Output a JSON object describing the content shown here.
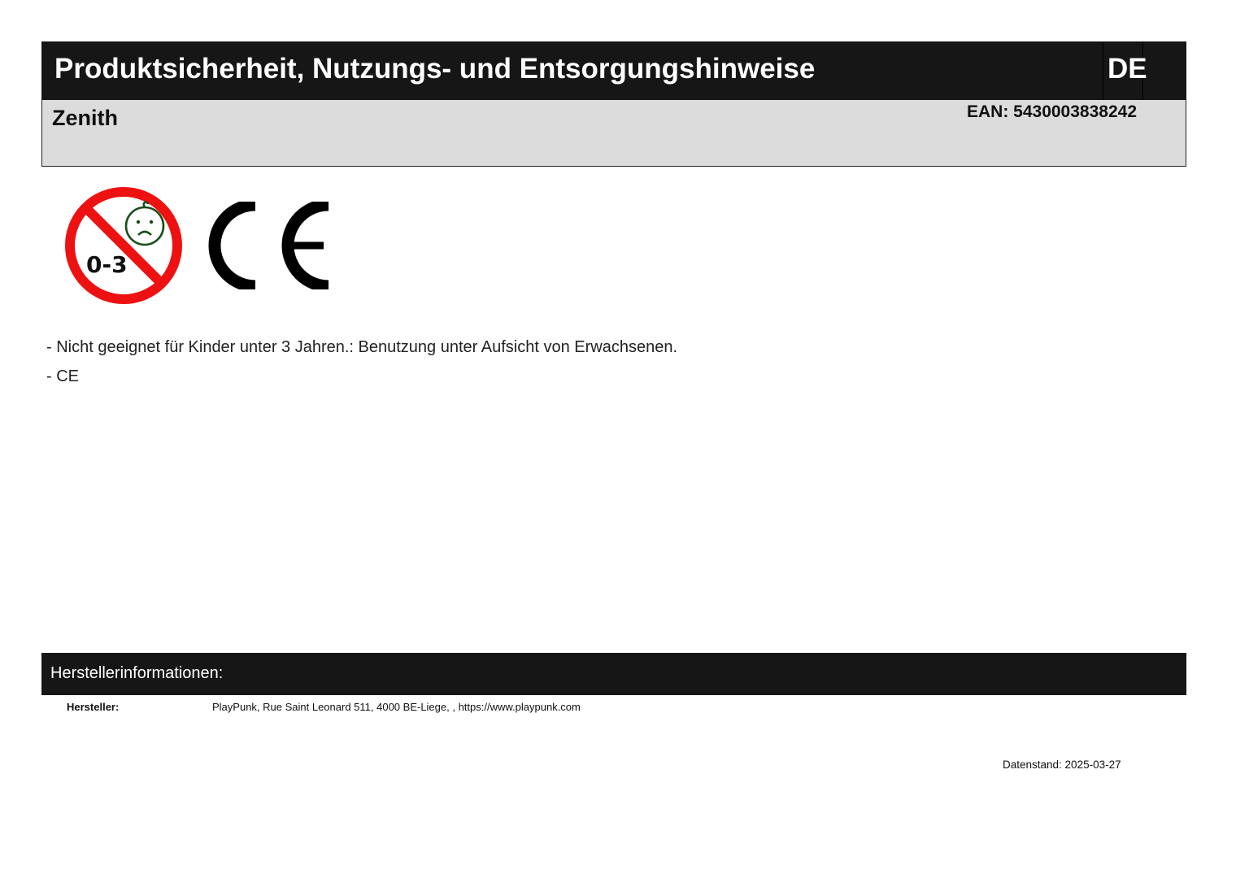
{
  "header": {
    "title": "Produktsicherheit, Nutzungs- und Entsorgungshinweise",
    "language": "DE"
  },
  "product": {
    "name": "Zenith",
    "ean": "EAN: 5430003838242"
  },
  "icons": {
    "age_warning": {
      "name": "not-for-under-3-icon",
      "label": "0-3",
      "ring_color": "#ee1111",
      "face_color": "#1a4d1a"
    },
    "ce_mark": {
      "name": "ce-mark-icon"
    }
  },
  "bullets": [
    "- Nicht geeignet für Kinder unter 3 Jahren.: Benutzung unter Aufsicht von Erwachsenen.",
    "- CE"
  ],
  "manufacturer": {
    "section_title": "Herstellerinformationen:",
    "label": "Hersteller:",
    "value": "PlayPunk, Rue Saint Leonard 511, 4000 BE-Liege, , https://www.playpunk.com"
  },
  "footer": {
    "date": "Datenstand: 2025-03-27"
  }
}
